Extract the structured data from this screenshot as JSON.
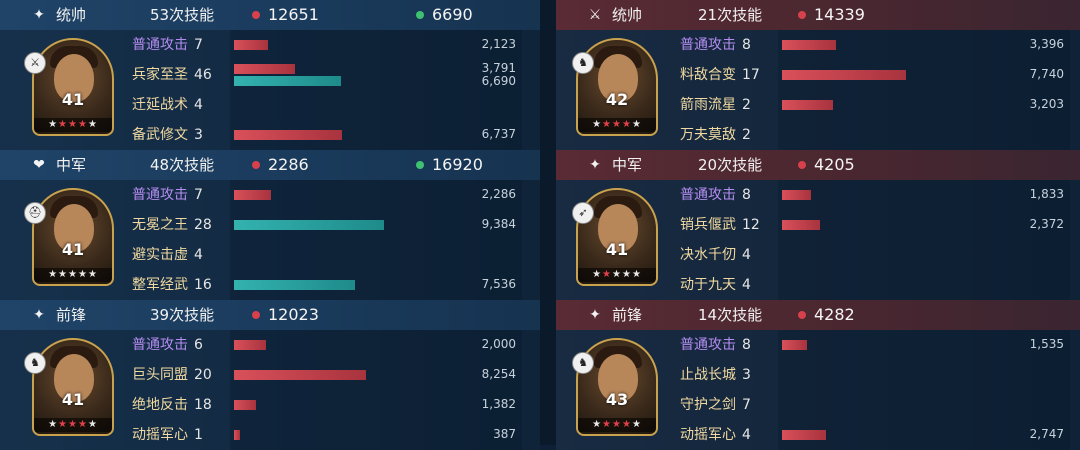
{
  "teams": [
    {
      "side": "left",
      "units": [
        {
          "role": "统帅",
          "casts": "53次技能",
          "damage": "12651",
          "heal": "6690",
          "level": "41",
          "stars_total": 5,
          "stars_red": 3,
          "skills": [
            {
              "name": "普通攻击",
              "count": "7",
              "attack": true,
              "bars": [
                {
                  "type": "dmg",
                  "value": 2123,
                  "label": "2,123"
                }
              ]
            },
            {
              "name": "兵家至圣",
              "count": "46",
              "attack": false,
              "bars": [
                {
                  "type": "dmg",
                  "value": 3791,
                  "label": "3,791"
                },
                {
                  "type": "heal",
                  "value": 6690,
                  "label": "6,690"
                }
              ]
            },
            {
              "name": "迁延战术",
              "count": "4",
              "attack": false,
              "bars": []
            },
            {
              "name": "备武修文",
              "count": "3",
              "attack": false,
              "bars": [
                {
                  "type": "dmg",
                  "value": 6737,
                  "label": "6,737"
                }
              ]
            }
          ]
        },
        {
          "role": "中军",
          "casts": "48次技能",
          "damage": "2286",
          "heal": "16920",
          "level": "41",
          "stars_total": 5,
          "stars_red": 0,
          "skills": [
            {
              "name": "普通攻击",
              "count": "7",
              "attack": true,
              "bars": [
                {
                  "type": "dmg",
                  "value": 2286,
                  "label": "2,286"
                }
              ]
            },
            {
              "name": "无冕之王",
              "count": "28",
              "attack": false,
              "bars": [
                {
                  "type": "heal",
                  "value": 9384,
                  "label": "9,384"
                }
              ]
            },
            {
              "name": "避实击虚",
              "count": "4",
              "attack": false,
              "bars": []
            },
            {
              "name": "整军经武",
              "count": "16",
              "attack": false,
              "bars": [
                {
                  "type": "heal",
                  "value": 7536,
                  "label": "7,536"
                }
              ]
            }
          ]
        },
        {
          "role": "前锋",
          "casts": "39次技能",
          "damage": "12023",
          "heal": "",
          "level": "41",
          "stars_total": 5,
          "stars_red": 3,
          "skills": [
            {
              "name": "普通攻击",
              "count": "6",
              "attack": true,
              "bars": [
                {
                  "type": "dmg",
                  "value": 2000,
                  "label": "2,000"
                }
              ]
            },
            {
              "name": "巨头同盟",
              "count": "20",
              "attack": false,
              "bars": [
                {
                  "type": "dmg",
                  "value": 8254,
                  "label": "8,254"
                }
              ]
            },
            {
              "name": "绝地反击",
              "count": "18",
              "attack": false,
              "bars": [
                {
                  "type": "dmg",
                  "value": 1382,
                  "label": "1,382"
                }
              ]
            },
            {
              "name": "动摇军心",
              "count": "1",
              "attack": false,
              "bars": [
                {
                  "type": "dmg",
                  "value": 387,
                  "label": "387"
                }
              ]
            }
          ]
        }
      ]
    },
    {
      "side": "right",
      "units": [
        {
          "role": "统帅",
          "casts": "21次技能",
          "damage": "14339",
          "heal": "",
          "level": "42",
          "stars_total": 5,
          "stars_red": 3,
          "skills": [
            {
              "name": "普通攻击",
              "count": "8",
              "attack": true,
              "bars": [
                {
                  "type": "dmg",
                  "value": 3396,
                  "label": "3,396"
                }
              ]
            },
            {
              "name": "料敌合变",
              "count": "17",
              "attack": false,
              "bars": [
                {
                  "type": "dmg",
                  "value": 7740,
                  "label": "7,740"
                }
              ]
            },
            {
              "name": "箭雨流星",
              "count": "2",
              "attack": false,
              "bars": [
                {
                  "type": "dmg",
                  "value": 3203,
                  "label": "3,203"
                }
              ]
            },
            {
              "name": "万夫莫敌",
              "count": "2",
              "attack": false,
              "bars": []
            }
          ]
        },
        {
          "role": "中军",
          "casts": "20次技能",
          "damage": "4205",
          "heal": "",
          "level": "41",
          "stars_total": 5,
          "stars_red": 1,
          "skills": [
            {
              "name": "普通攻击",
              "count": "8",
              "attack": true,
              "bars": [
                {
                  "type": "dmg",
                  "value": 1833,
                  "label": "1,833"
                }
              ]
            },
            {
              "name": "销兵偃武",
              "count": "12",
              "attack": false,
              "bars": [
                {
                  "type": "dmg",
                  "value": 2372,
                  "label": "2,372"
                }
              ]
            },
            {
              "name": "决水千仞",
              "count": "4",
              "attack": false,
              "bars": []
            },
            {
              "name": "动于九天",
              "count": "4",
              "attack": false,
              "bars": []
            }
          ]
        },
        {
          "role": "前锋",
          "casts": "14次技能",
          "damage": "4282",
          "heal": "",
          "level": "43",
          "stars_total": 5,
          "stars_red": 3,
          "skills": [
            {
              "name": "普通攻击",
              "count": "8",
              "attack": true,
              "bars": [
                {
                  "type": "dmg",
                  "value": 1535,
                  "label": "1,535"
                }
              ]
            },
            {
              "name": "止战长城",
              "count": "3",
              "attack": false,
              "bars": []
            },
            {
              "name": "守护之剑",
              "count": "7",
              "attack": false,
              "bars": []
            },
            {
              "name": "动摇军心",
              "count": "4",
              "attack": false,
              "bars": [
                {
                  "type": "dmg",
                  "value": 2747,
                  "label": "2,747"
                }
              ]
            }
          ]
        }
      ]
    }
  ],
  "bar_scale_max": 10000,
  "icons": {
    "role_icons": [
      "sparkle-icon",
      "heart-shield-icon",
      "sparkle-icon",
      "crossed-swords-icon",
      "sparkle-icon",
      "sparkle-icon"
    ],
    "badge_icons": [
      "sword-icon",
      "helmet-icon",
      "horse-icon",
      "horse-icon",
      "bow-icon",
      "horse-icon"
    ]
  },
  "colors": {
    "damage": "#d6414c",
    "heal": "#3ec271",
    "heal_bar": "#2aa3a2",
    "attack_skill": "#b48cf0",
    "skill_name": "#f0d9a0"
  }
}
